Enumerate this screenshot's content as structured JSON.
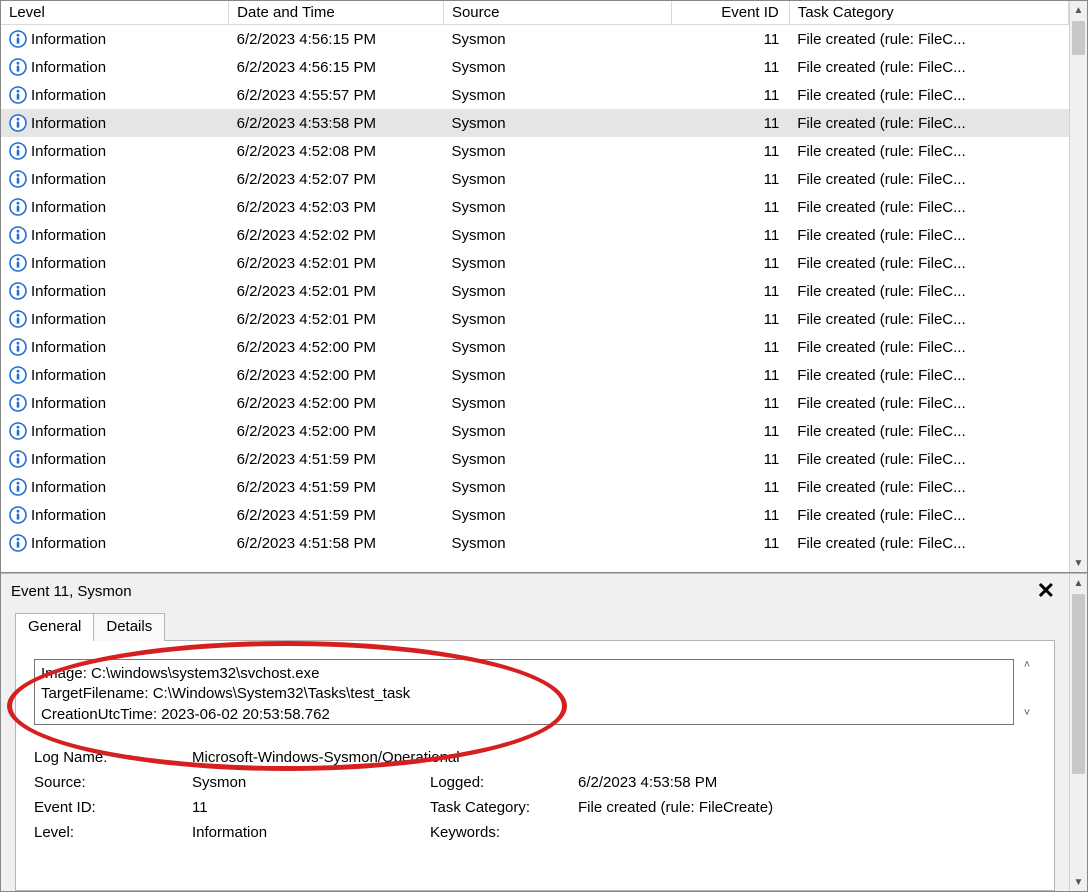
{
  "columns": {
    "level": "Level",
    "date": "Date and Time",
    "source": "Source",
    "eventid": "Event ID",
    "category": "Task Category"
  },
  "rows": [
    {
      "level": "Information",
      "date": "6/2/2023 4:56:15 PM",
      "source": "Sysmon",
      "eventid": "11",
      "category": "File created (rule: FileC..."
    },
    {
      "level": "Information",
      "date": "6/2/2023 4:56:15 PM",
      "source": "Sysmon",
      "eventid": "11",
      "category": "File created (rule: FileC..."
    },
    {
      "level": "Information",
      "date": "6/2/2023 4:55:57 PM",
      "source": "Sysmon",
      "eventid": "11",
      "category": "File created (rule: FileC..."
    },
    {
      "level": "Information",
      "date": "6/2/2023 4:53:58 PM",
      "source": "Sysmon",
      "eventid": "11",
      "category": "File created (rule: FileC...",
      "selected": true
    },
    {
      "level": "Information",
      "date": "6/2/2023 4:52:08 PM",
      "source": "Sysmon",
      "eventid": "11",
      "category": "File created (rule: FileC..."
    },
    {
      "level": "Information",
      "date": "6/2/2023 4:52:07 PM",
      "source": "Sysmon",
      "eventid": "11",
      "category": "File created (rule: FileC..."
    },
    {
      "level": "Information",
      "date": "6/2/2023 4:52:03 PM",
      "source": "Sysmon",
      "eventid": "11",
      "category": "File created (rule: FileC..."
    },
    {
      "level": "Information",
      "date": "6/2/2023 4:52:02 PM",
      "source": "Sysmon",
      "eventid": "11",
      "category": "File created (rule: FileC..."
    },
    {
      "level": "Information",
      "date": "6/2/2023 4:52:01 PM",
      "source": "Sysmon",
      "eventid": "11",
      "category": "File created (rule: FileC..."
    },
    {
      "level": "Information",
      "date": "6/2/2023 4:52:01 PM",
      "source": "Sysmon",
      "eventid": "11",
      "category": "File created (rule: FileC..."
    },
    {
      "level": "Information",
      "date": "6/2/2023 4:52:01 PM",
      "source": "Sysmon",
      "eventid": "11",
      "category": "File created (rule: FileC..."
    },
    {
      "level": "Information",
      "date": "6/2/2023 4:52:00 PM",
      "source": "Sysmon",
      "eventid": "11",
      "category": "File created (rule: FileC..."
    },
    {
      "level": "Information",
      "date": "6/2/2023 4:52:00 PM",
      "source": "Sysmon",
      "eventid": "11",
      "category": "File created (rule: FileC..."
    },
    {
      "level": "Information",
      "date": "6/2/2023 4:52:00 PM",
      "source": "Sysmon",
      "eventid": "11",
      "category": "File created (rule: FileC..."
    },
    {
      "level": "Information",
      "date": "6/2/2023 4:52:00 PM",
      "source": "Sysmon",
      "eventid": "11",
      "category": "File created (rule: FileC..."
    },
    {
      "level": "Information",
      "date": "6/2/2023 4:51:59 PM",
      "source": "Sysmon",
      "eventid": "11",
      "category": "File created (rule: FileC..."
    },
    {
      "level": "Information",
      "date": "6/2/2023 4:51:59 PM",
      "source": "Sysmon",
      "eventid": "11",
      "category": "File created (rule: FileC..."
    },
    {
      "level": "Information",
      "date": "6/2/2023 4:51:59 PM",
      "source": "Sysmon",
      "eventid": "11",
      "category": "File created (rule: FileC..."
    },
    {
      "level": "Information",
      "date": "6/2/2023 4:51:58 PM",
      "source": "Sysmon",
      "eventid": "11",
      "category": "File created (rule: FileC..."
    }
  ],
  "detail": {
    "title": "Event 11, Sysmon",
    "tabs": {
      "general": "General",
      "details": "Details"
    },
    "message": {
      "line1": "Image: C:\\windows\\system32\\svchost.exe",
      "line2": "TargetFilename: C:\\Windows\\System32\\Tasks\\test_task",
      "line3": "CreationUtcTime: 2023-06-02 20:53:58.762"
    },
    "meta": {
      "lognameLabel": "Log Name:",
      "logname": "Microsoft-Windows-Sysmon/Operational",
      "sourceLabel": "Source:",
      "source": "Sysmon",
      "loggedLabel": "Logged:",
      "logged": "6/2/2023 4:53:58 PM",
      "eventidLabel": "Event ID:",
      "eventid": "11",
      "taskcatLabel": "Task Category:",
      "taskcat": "File created (rule: FileCreate)",
      "levelLabel": "Level:",
      "level": "Information",
      "keywordsLabel": "Keywords:",
      "keywords": ""
    }
  }
}
